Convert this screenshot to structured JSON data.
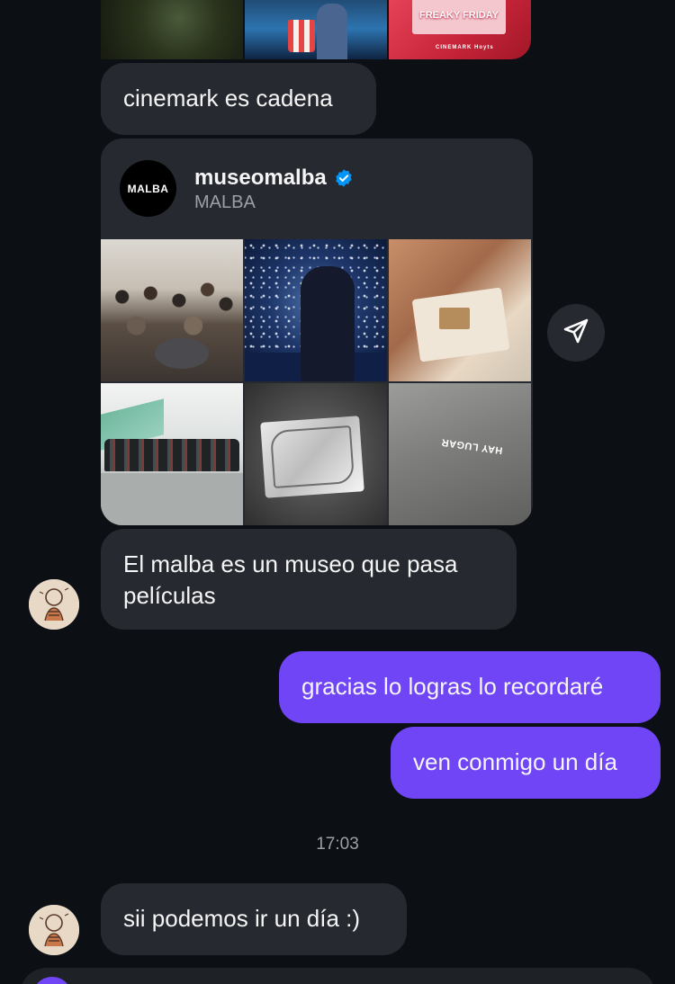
{
  "messages": {
    "m1_text": "cinemark es cadena",
    "m2_text": "El malba es un museo que pasa películas",
    "m3_text": "gracias lo logras lo recordaré",
    "m4_text": "ven conmigo un día",
    "m5_text": "sii podemos ir un día :)"
  },
  "top_strip": {
    "poster_title": "FREAKY FRIDAY",
    "poster_brand": "CINEMARK Hoyts"
  },
  "shared_post": {
    "logo_text": "MALBA",
    "username": "museomalba",
    "subname": "MALBA",
    "tile_stamp_text": "HAY LUGAR"
  },
  "timestamp": "17:03",
  "icons": {
    "verified": "verified-badge-icon",
    "share": "paper-plane-icon",
    "avatar": "contact-avatar",
    "camera": "camera-icon"
  },
  "colors": {
    "background": "#0c1014",
    "incoming_bubble": "#262a30",
    "outgoing_bubble": "#7045f5",
    "verified_blue": "#0095f6"
  }
}
